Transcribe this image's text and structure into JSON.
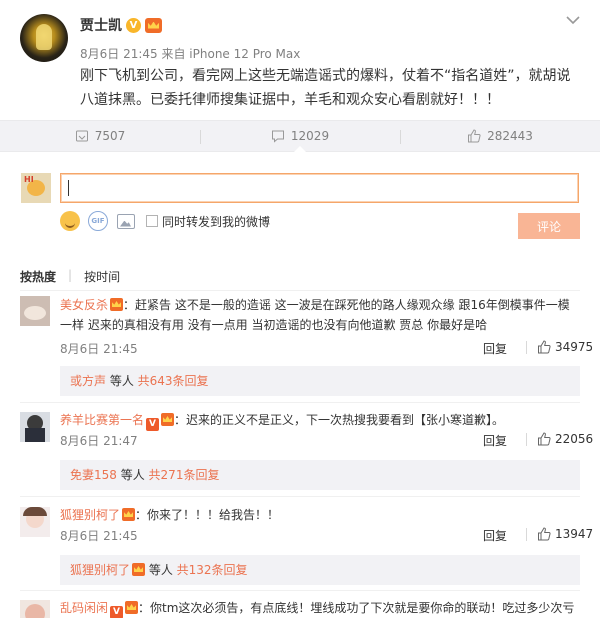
{
  "post": {
    "author": "贾士凯",
    "meta": "8月6日 21:45 来自 iPhone 12 Pro Max",
    "text": "刚下飞机到公司，看完网上这些无端造谣式的爆料，仗着不“指名道姓”，就胡说八道抹黑。已委托律师搜集证据中，羊毛和观众安心看剧就好！！！",
    "verified_icon": "verified-v-icon",
    "more_icon": "chevron-down-icon"
  },
  "actions": [
    {
      "icon": "repost-icon",
      "count": "7507"
    },
    {
      "icon": "comment-icon",
      "count": "12029"
    },
    {
      "icon": "like-icon",
      "count": "282443"
    }
  ],
  "composer": {
    "input_value": "",
    "forward_label": "同时转发到我的微博",
    "submit_label": "评论"
  },
  "sort": {
    "hot": "按热度",
    "time": "按时间"
  },
  "comments": [
    {
      "name": "美女反杀",
      "text": "：赶紧告 这不是一般的造谣 这一波是在踩死他的路人缘观众缘 跟16年倒模事件一模一样 迟来的真相没有用 没有一点用 当初造谣的也没有向他道歉 贾总 你最好是哈",
      "time": "8月6日 21:45",
      "reply": "回复",
      "likes": "34975",
      "sub_name": "或方声",
      "sub_mid": " 等人 ",
      "sub_count": "共643条回复"
    },
    {
      "name": "养羊比赛第一名",
      "text": "：迟来的正义不是正义，下一次热搜我要看到【张小寒道歉】。",
      "time": "8月6日 21:47",
      "reply": "回复",
      "likes": "22056",
      "sub_name": "免妻158",
      "sub_mid": " 等人 ",
      "sub_count": "共271条回复"
    },
    {
      "name": "狐狸别柯了",
      "text": "：你来了！！！给我告！！",
      "time": "8月6日 21:45",
      "reply": "回复",
      "likes": "13947",
      "sub_name": "狐狸别柯了",
      "sub_mid": " 等人 ",
      "sub_count": "共132条回复"
    },
    {
      "name": "乱码闲闲",
      "text": "：你tm这次必须告，有点底线！埋线成功了下次就是要你命的联动！吃过多少次亏"
    }
  ]
}
